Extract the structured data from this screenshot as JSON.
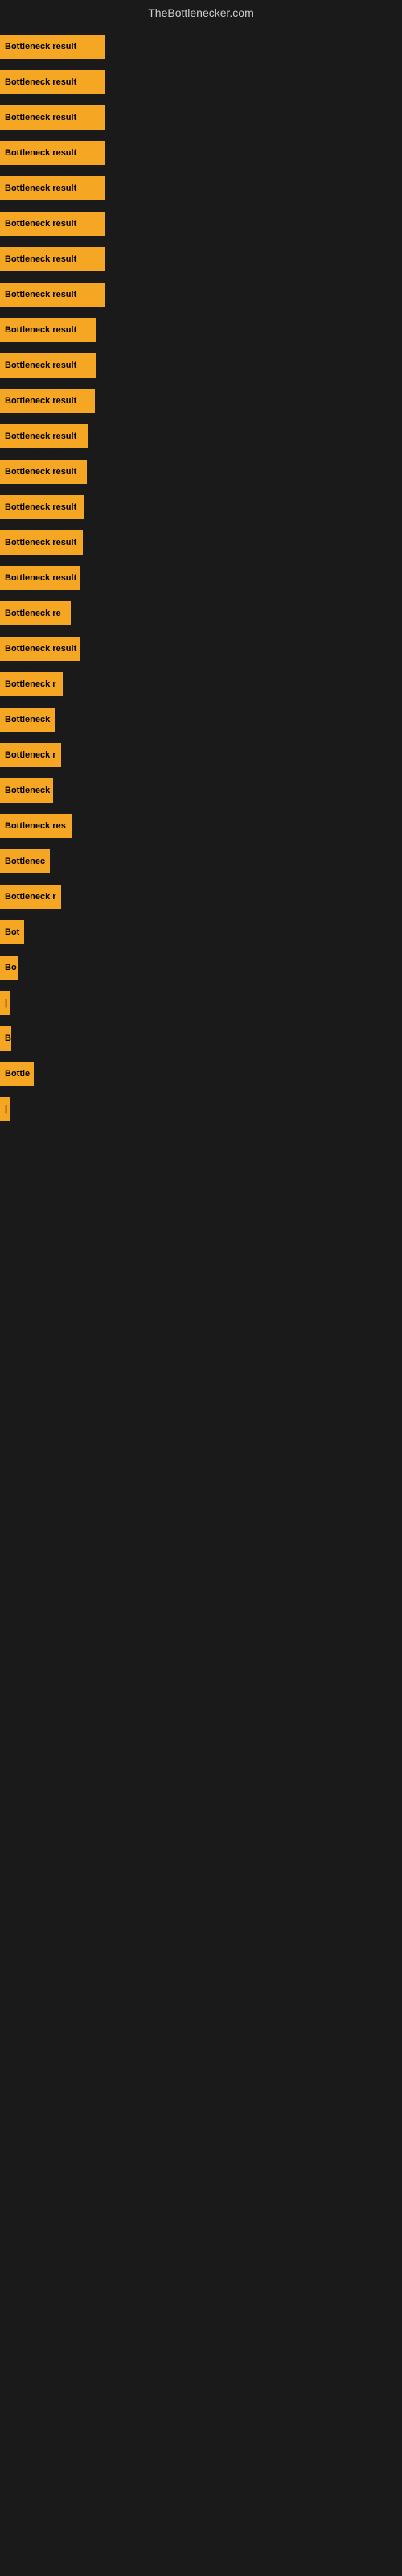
{
  "site": {
    "title": "TheBottlenecker.com"
  },
  "bars": [
    {
      "label": "Bottleneck result",
      "width": 130
    },
    {
      "label": "Bottleneck result",
      "width": 130
    },
    {
      "label": "Bottleneck result",
      "width": 130
    },
    {
      "label": "Bottleneck result",
      "width": 130
    },
    {
      "label": "Bottleneck result",
      "width": 130
    },
    {
      "label": "Bottleneck result",
      "width": 130
    },
    {
      "label": "Bottleneck result",
      "width": 130
    },
    {
      "label": "Bottleneck result",
      "width": 130
    },
    {
      "label": "Bottleneck result",
      "width": 120
    },
    {
      "label": "Bottleneck result",
      "width": 120
    },
    {
      "label": "Bottleneck result",
      "width": 118
    },
    {
      "label": "Bottleneck result",
      "width": 110
    },
    {
      "label": "Bottleneck result",
      "width": 108
    },
    {
      "label": "Bottleneck result",
      "width": 105
    },
    {
      "label": "Bottleneck result",
      "width": 103
    },
    {
      "label": "Bottleneck result",
      "width": 100
    },
    {
      "label": "Bottleneck re",
      "width": 88
    },
    {
      "label": "Bottleneck result",
      "width": 100
    },
    {
      "label": "Bottleneck r",
      "width": 78
    },
    {
      "label": "Bottleneck",
      "width": 68
    },
    {
      "label": "Bottleneck r",
      "width": 76
    },
    {
      "label": "Bottleneck",
      "width": 66
    },
    {
      "label": "Bottleneck res",
      "width": 90
    },
    {
      "label": "Bottlenec",
      "width": 62
    },
    {
      "label": "Bottleneck r",
      "width": 76
    },
    {
      "label": "Bot",
      "width": 30
    },
    {
      "label": "Bo",
      "width": 22
    },
    {
      "label": "|",
      "width": 6
    },
    {
      "label": "B",
      "width": 14
    },
    {
      "label": "Bottle",
      "width": 42
    },
    {
      "label": "|",
      "width": 6
    }
  ]
}
